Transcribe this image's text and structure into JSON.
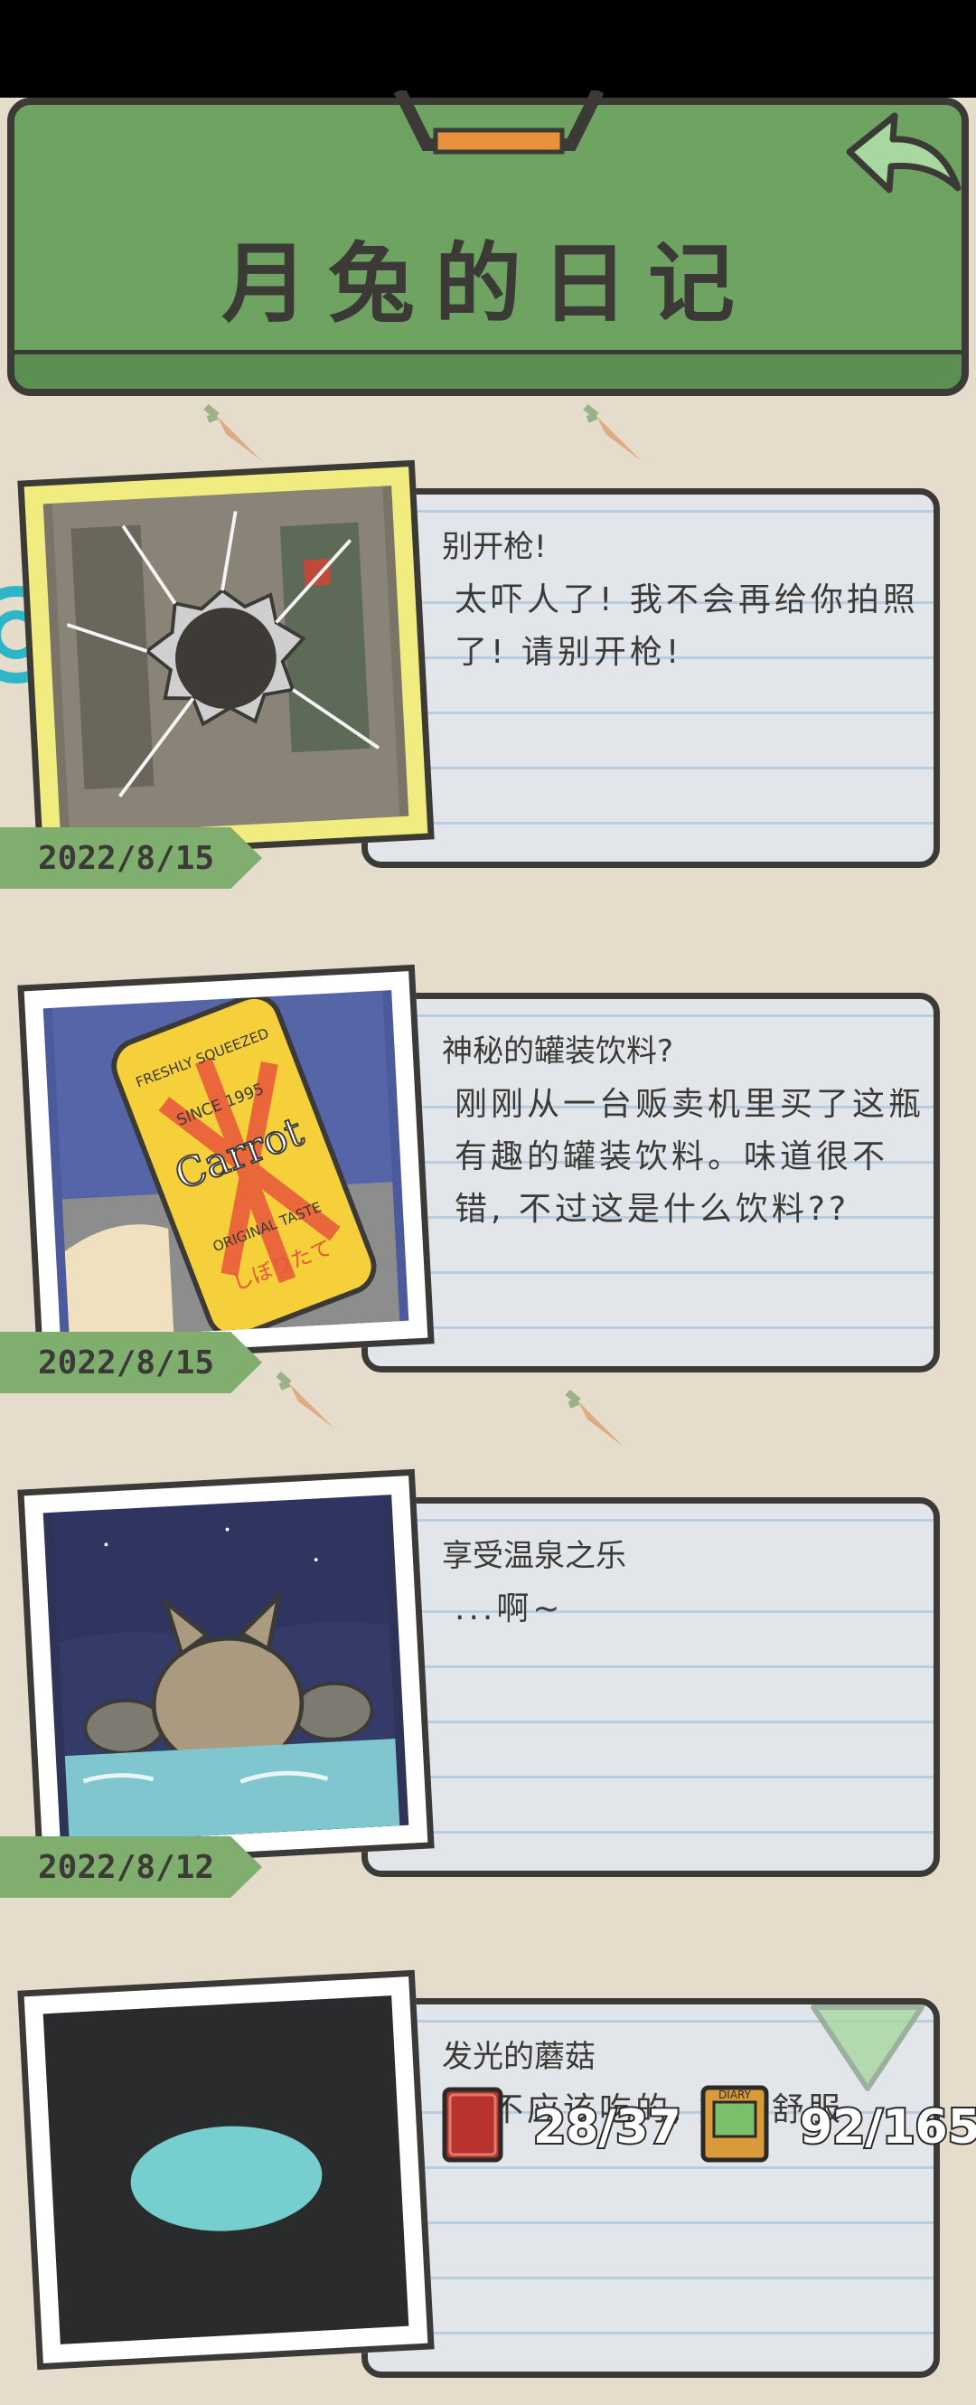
{
  "header": {
    "title": "月兔的日记"
  },
  "entries": [
    {
      "title": "别开枪!",
      "body": "太吓人了! 我不会再给你拍照了! 请别开枪!",
      "date": "2022/8/15"
    },
    {
      "title": "神秘的罐装饮料?",
      "body": "刚刚从一台贩卖机里买了这瓶有趣的罐装饮料。味道很不错, 不过这是什么饮料??",
      "date": "2022/8/15"
    },
    {
      "title": "享受温泉之乐",
      "body": "...啊~",
      "date": "2022/8/12"
    },
    {
      "title": "发光的蘑菇",
      "body": "我不应该吃的, 好不舒服",
      "date": ""
    }
  ],
  "can_labels": {
    "top": "FRESHLY SQUEEZED",
    "since": "SINCE 1995",
    "brand": "Carrot",
    "bottom": "ORIGINAL TASTE",
    "jp": "しぼりたて"
  },
  "counters": {
    "diary": "28/37",
    "photos": "92/165"
  },
  "book_labels": {
    "diary": "DIARY"
  }
}
